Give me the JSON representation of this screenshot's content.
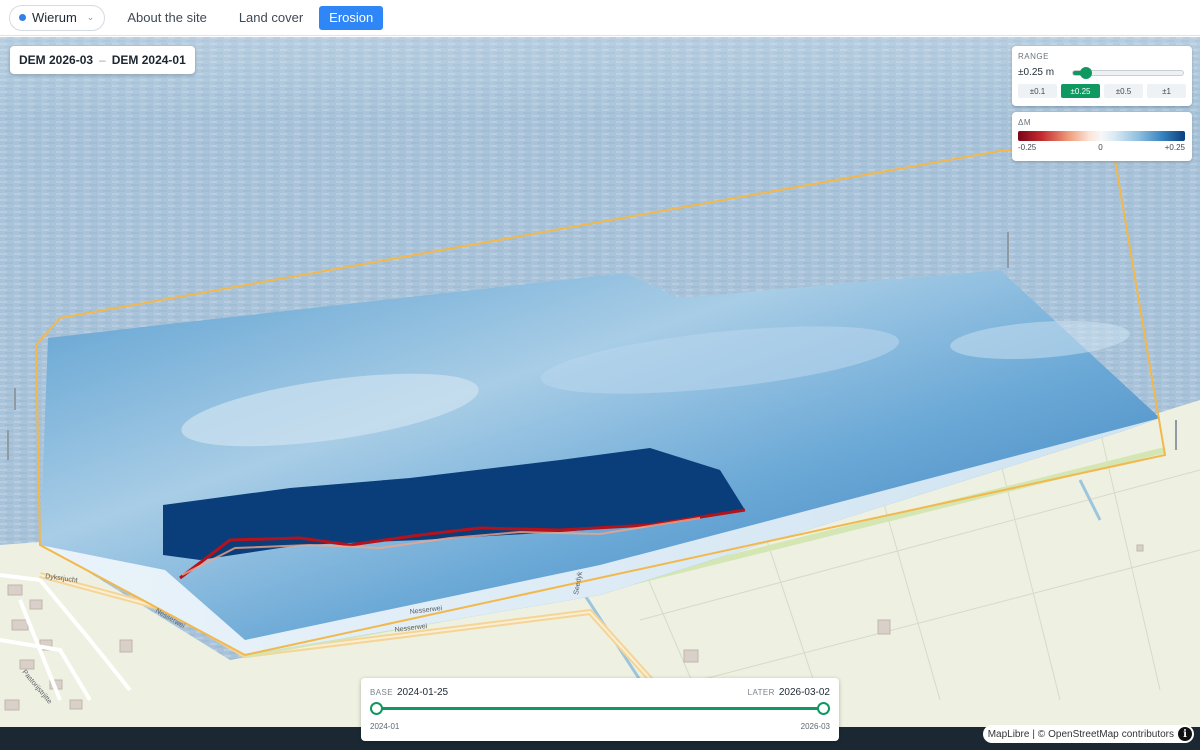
{
  "header": {
    "site_selector": {
      "label": "Wierum",
      "dot_color": "#2f80ed"
    },
    "tabs": [
      {
        "label": "About the site",
        "active": false
      },
      {
        "label": "Land cover",
        "active": false
      },
      {
        "label": "Erosion",
        "active": true
      }
    ],
    "accent_color": "#2f86f6"
  },
  "comparison": {
    "later_label": "DEM 2026-03",
    "separator": "–",
    "base_label": "DEM 2024-01"
  },
  "range_panel": {
    "title": "RANGE",
    "value_label": "±0.25 m",
    "slider_fraction": 0.12,
    "presets": [
      {
        "label": "±0.1",
        "active": false
      },
      {
        "label": "±0.25",
        "active": true
      },
      {
        "label": "±0.5",
        "active": false
      },
      {
        "label": "±1",
        "active": false
      }
    ],
    "accent_color": "#0f9860"
  },
  "legend": {
    "title": "ΔM",
    "min_label": "-0.25",
    "mid_label": "0",
    "max_label": "+0.25"
  },
  "map_labels": {
    "roads": [
      "Dyksrjucht",
      "Nesserwei",
      "Nesserwei",
      "Nesserwei",
      "Seedyk",
      "Pastorijstrjitte"
    ]
  },
  "timeline": {
    "base_title": "BASE",
    "base_date": "2024-01-25",
    "later_title": "LATER",
    "later_date": "2026-03-02",
    "start_label": "2024-01",
    "end_label": "2026-03"
  },
  "attribution": {
    "maplibre": "MapLibre",
    "separator": "| ©",
    "osm": "OpenStreetMap",
    "contributors": "contributors",
    "info_glyph": "i"
  }
}
